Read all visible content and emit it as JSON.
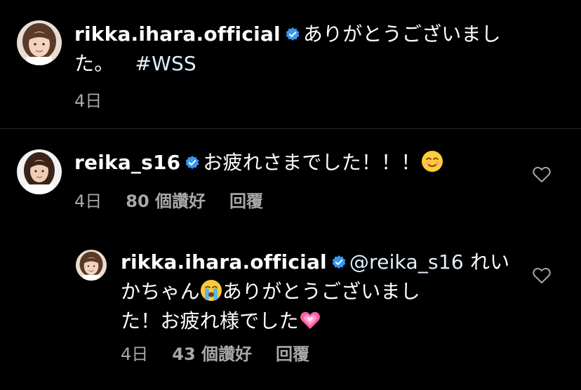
{
  "comments": [
    {
      "username": "rikka.ihara.official",
      "text_line1": "ありがとうございまし",
      "text_line2": "た。",
      "hashtag": "#WSS",
      "time": "4日"
    },
    {
      "username": "reika_s16",
      "text": "お疲れさまでした！！！",
      "emoji": "smiling-face-emoji",
      "time": "4日",
      "likes": "80 個讚好",
      "reply": "回覆"
    },
    {
      "username": "rikka.ihara.official",
      "mention": "@reika_s16",
      "text_part1": "れい",
      "text_line2a": "かちゃん",
      "emoji1": "crying-face-emoji",
      "text_line2b": "ありがとうございまし",
      "text_line3": "た！お疲れ様でした",
      "emoji2": "growing-heart-emoji",
      "time": "4日",
      "likes": "43 個讚好",
      "reply": "回覆"
    }
  ],
  "colors": {
    "background": "#000000",
    "text": "#ffffff",
    "meta": "#a8a8a8",
    "verified": "#3897f0",
    "hashtag": "#e0f1ff",
    "divider": "#262626"
  }
}
